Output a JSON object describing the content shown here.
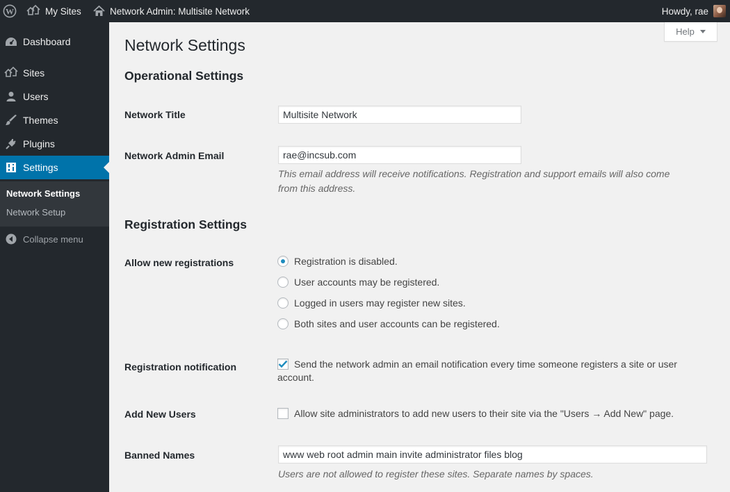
{
  "adminbar": {
    "my_sites": "My Sites",
    "network_admin": "Network Admin: Multisite Network",
    "howdy": "Howdy, rae"
  },
  "sidebar": {
    "items": [
      {
        "label": "Dashboard",
        "icon": "dashboard-icon"
      },
      {
        "label": "Sites",
        "icon": "sites-icon"
      },
      {
        "label": "Users",
        "icon": "users-icon"
      },
      {
        "label": "Themes",
        "icon": "themes-icon"
      },
      {
        "label": "Plugins",
        "icon": "plugins-icon"
      },
      {
        "label": "Settings",
        "icon": "settings-icon"
      }
    ],
    "submenu": [
      "Network Settings",
      "Network Setup"
    ],
    "collapse": "Collapse menu"
  },
  "help": "Help",
  "page_title": "Network Settings",
  "operational": {
    "title": "Operational Settings",
    "network_title_label": "Network Title",
    "network_title_value": "Multisite Network",
    "admin_email_label": "Network Admin Email",
    "admin_email_value": "rae@incsub.com",
    "admin_email_desc_1": "This email address will receive notifications. Registration and support emails will also come",
    "admin_email_desc_2": "from this address."
  },
  "registration": {
    "title": "Registration Settings",
    "allow_label": "Allow new registrations",
    "options": [
      {
        "label": "Registration is disabled.",
        "checked": true
      },
      {
        "label": "User accounts may be registered.",
        "checked": false
      },
      {
        "label": "Logged in users may register new sites.",
        "checked": false
      },
      {
        "label": "Both sites and user accounts can be registered.",
        "checked": false
      }
    ],
    "notification_label": "Registration notification",
    "notification_text_1": "Send the network admin an email notification every time someone registers a site or user",
    "notification_text_2": "account.",
    "notification_checked": true,
    "add_users_label": "Add New Users",
    "add_users_text": "Allow site administrators to add new users to their site via the \"Users → Add New\" page.",
    "add_users_checked": false,
    "banned_label": "Banned Names",
    "banned_value": "www web root admin main invite administrator files blog",
    "banned_desc": "Users are not allowed to register these sites. Separate names by spaces."
  },
  "colors": {
    "admin_bar": "#23282d",
    "menu_active": "#0073aa",
    "submenu_bg": "#32373c",
    "content_bg": "#f1f1f1",
    "check_blue": "#1e8cbe"
  }
}
